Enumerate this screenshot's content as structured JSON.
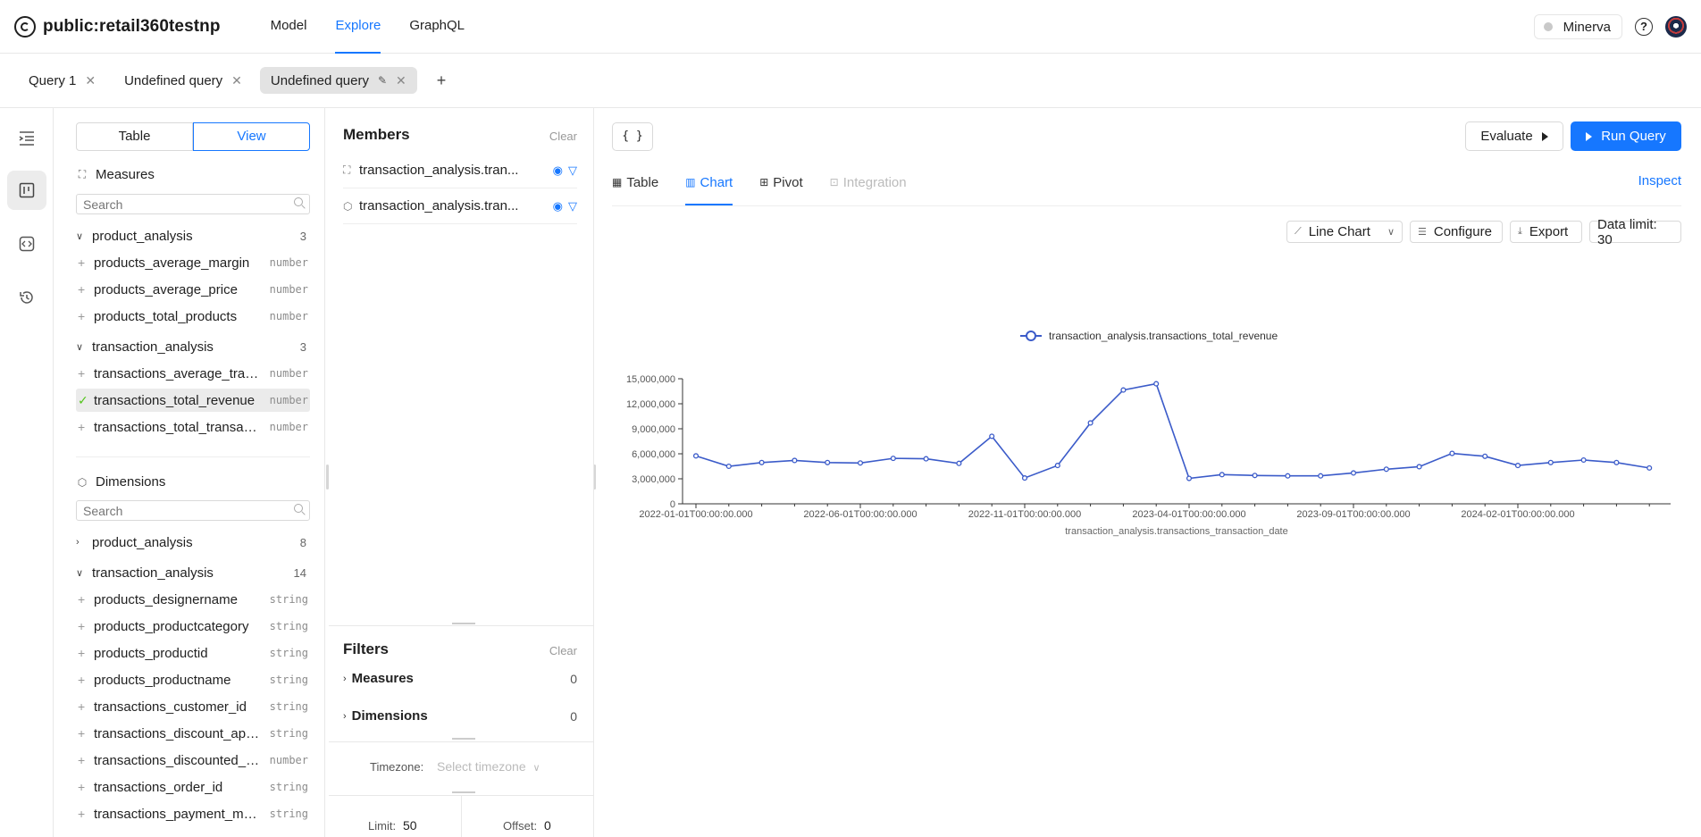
{
  "header": {
    "title": "public:retail360testnp",
    "nav": [
      "Model",
      "Explore",
      "GraphQL"
    ],
    "active_nav": "Explore",
    "datasource": "Minerva",
    "help": "?"
  },
  "tabs": [
    {
      "label": "Query 1"
    },
    {
      "label": "Undefined query"
    },
    {
      "label": "Undefined query"
    }
  ],
  "left": {
    "toggle": {
      "table": "Table",
      "view": "View"
    },
    "measures": {
      "title": "Measures",
      "search_placeholder": "Search",
      "groups": [
        {
          "name": "product_analysis",
          "count": "3",
          "items": [
            {
              "name": "products_average_margin",
              "type": "number"
            },
            {
              "name": "products_average_price",
              "type": "number"
            },
            {
              "name": "products_total_products",
              "type": "number"
            }
          ]
        },
        {
          "name": "transaction_analysis",
          "count": "3",
          "items": [
            {
              "name": "transactions_average_tran...",
              "type": "number"
            },
            {
              "name": "transactions_total_revenue",
              "type": "number"
            },
            {
              "name": "transactions_total_transact...",
              "type": "number"
            }
          ]
        }
      ]
    },
    "dimensions": {
      "title": "Dimensions",
      "search_placeholder": "Search",
      "groups": [
        {
          "name": "product_analysis",
          "count": "8"
        },
        {
          "name": "transaction_analysis",
          "count": "14",
          "items": [
            {
              "name": "products_designername",
              "type": "string"
            },
            {
              "name": "products_productcategory",
              "type": "string"
            },
            {
              "name": "products_productid",
              "type": "string"
            },
            {
              "name": "products_productname",
              "type": "string"
            },
            {
              "name": "transactions_customer_id",
              "type": "string"
            },
            {
              "name": "transactions_discount_appl...",
              "type": "string"
            },
            {
              "name": "transactions_discounted_a...",
              "type": "number"
            },
            {
              "name": "transactions_order_id",
              "type": "string"
            },
            {
              "name": "transactions_payment_met...",
              "type": "string"
            }
          ]
        }
      ]
    }
  },
  "members": {
    "title": "Members",
    "clear": "Clear",
    "items": [
      {
        "name": "transaction_analysis.tran..."
      },
      {
        "name": "transaction_analysis.tran..."
      }
    ]
  },
  "filters": {
    "title": "Filters",
    "clear": "Clear",
    "rows": [
      {
        "label": "Measures",
        "count": "0"
      },
      {
        "label": "Dimensions",
        "count": "0"
      }
    ],
    "timezone_label": "Timezone:",
    "timezone_placeholder": "Select timezone",
    "limit_label": "Limit:",
    "limit_value": "50",
    "offset_label": "Offset:",
    "offset_value": "0"
  },
  "main": {
    "json_button": "{ }",
    "evaluate": "Evaluate",
    "run_query": "Run Query",
    "view_tabs": [
      "Table",
      "Chart",
      "Pivot",
      "Integration"
    ],
    "active_tab": "Chart",
    "inspect": "Inspect",
    "chart_type": "Line Chart",
    "configure": "Configure",
    "export": "Export",
    "data_limit": "Data limit: 30"
  },
  "colors": {
    "accent": "#1677ff",
    "line": "#3b5bc9"
  },
  "chart_data": {
    "type": "line",
    "legend": "transaction_analysis.transactions_total_revenue",
    "legend_position": "top",
    "xlabel": "transaction_analysis.transactions_transaction_date",
    "ylabel": "",
    "ylim": [
      0,
      15000000
    ],
    "yticks": [
      0,
      3000000,
      6000000,
      9000000,
      12000000,
      15000000
    ],
    "ytick_labels": [
      "0",
      "3,000,000",
      "6,000,000",
      "9,000,000",
      "12,000,000",
      "15,000,000"
    ],
    "xtick_labels": [
      "2022-01-01T00:00:00.000",
      "2022-06-01T00:00:00.000",
      "2022-11-01T00:00:00.000",
      "2023-04-01T00:00:00.000",
      "2023-09-01T00:00:00.000",
      "2024-02-01T00:00:00.000"
    ],
    "xtick_indices": [
      0,
      5,
      10,
      15,
      20,
      25
    ],
    "grid": false,
    "series": [
      {
        "name": "transaction_analysis.transactions_total_revenue",
        "values": [
          5750000,
          4500000,
          4950000,
          5200000,
          4950000,
          4900000,
          5450000,
          5400000,
          4850000,
          8100000,
          3100000,
          4600000,
          9700000,
          13650000,
          14400000,
          3050000,
          3500000,
          3400000,
          3350000,
          3350000,
          3700000,
          4150000,
          4450000,
          6050000,
          5700000,
          4600000,
          4950000,
          5250000,
          4950000,
          4300000
        ]
      }
    ]
  }
}
